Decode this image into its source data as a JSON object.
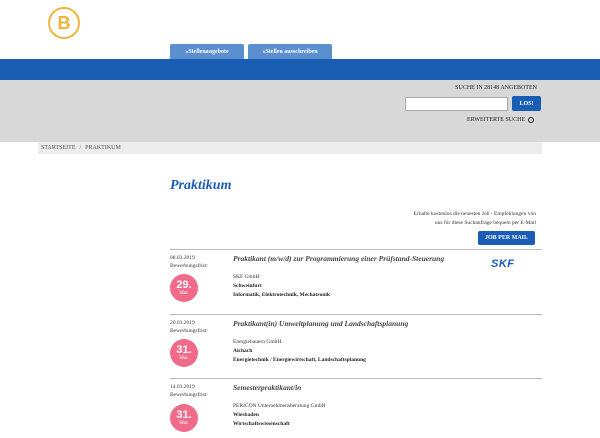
{
  "header": {
    "logo_letter": "B",
    "tabs": [
      {
        "label": "»Stellenangebote"
      },
      {
        "label": "»Stellen ausschreiben"
      }
    ]
  },
  "search": {
    "title": "SUCHE IN 28148 ANGEBOTEN",
    "input_value": "",
    "button_label": "LOS!",
    "advanced_label": "ERWEITERTE SUCHE"
  },
  "breadcrumb": {
    "items": [
      "STARTSEITE",
      "/",
      "PRAKTIKUM"
    ]
  },
  "main": {
    "title": "Praktikum",
    "mail_text_line1": "Erhalte kostenlos die neuesten Job - Empfehlungen von",
    "mail_text_line2": "uns für diese Suchanfrage bequem per E-Mail",
    "mail_button": "JOB PER MAIL"
  },
  "jobs": [
    {
      "date": "08.03.2019",
      "deadline_label": "Bewerbungsfrist:",
      "deadline_day": "29.",
      "deadline_month": "Mar.",
      "title": "Praktikant (m/w/d) zur Programmierung einer Prüfstand-Steuerung",
      "company": "SKF GmbH",
      "city": "Schweinfurt",
      "field": "Informatik, Elektrotechnik, Mechatronik",
      "logo_text": "SKF"
    },
    {
      "date": "20.03.2019",
      "deadline_label": "Bewerbungsfrist:",
      "deadline_day": "31.",
      "deadline_month": "Mar.",
      "title": "Praktikant(in) Umweltplanung und Landschaftsplanung",
      "company": "Energiebauern GmbH",
      "city": "Aichach",
      "field": "Energietechnik / Energiewirtschaft, Landschaftsplanung"
    },
    {
      "date": "14.03.2019",
      "deadline_label": "Bewerbungsfrist:",
      "deadline_day": "31.",
      "deadline_month": "Mar.",
      "title": "Semesterpraktikant/in",
      "company": "PERICON Unternehmensberatung GmbH",
      "city": "Wiesbaden",
      "field": "Wirtschaftswissenschaft"
    }
  ],
  "colors": {
    "brand_blue": "#1a5db5",
    "tab_blue": "#5b8fd0",
    "logo_gold": "#f0b43c",
    "deadline_pink": "#f06a8a",
    "search_band": "#d8d8d8"
  }
}
